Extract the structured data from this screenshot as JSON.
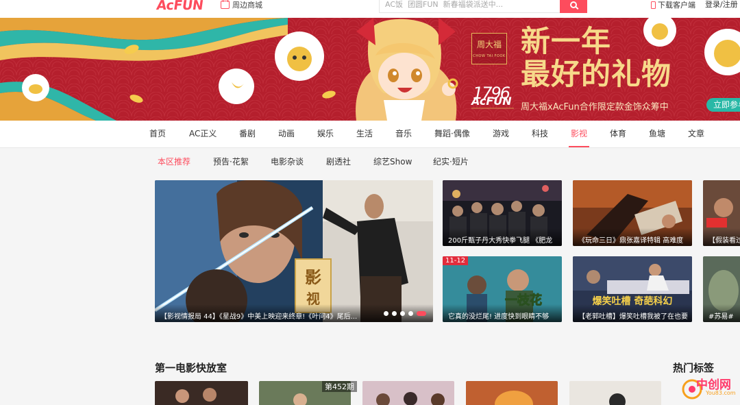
{
  "header": {
    "logo_text": "AcFUN",
    "mall_label": "周边商城",
    "search_placeholder": "AC饭  团圆FUN  新春福袋派送中...",
    "download_label": "下载客户端",
    "login_label": "登录/注册"
  },
  "banner": {
    "brand_cn": "周大福",
    "brand_en": "CHOW TAI FOOK",
    "number_mark": "1796",
    "logo_text": "AcFUN",
    "headline_line1": "新一年",
    "headline_line2": "最好的礼物",
    "collab_text": "周大福xAcFun合作限定款金饰众筹中",
    "join_button": "立即参与"
  },
  "nav": {
    "items": [
      "首页",
      "AC正义",
      "番剧",
      "动画",
      "娱乐",
      "生活",
      "音乐",
      "舞蹈·偶像",
      "游戏",
      "科技",
      "影视",
      "体育",
      "鱼塘",
      "文章"
    ],
    "active": "影视"
  },
  "subnav": {
    "items": [
      "本区推荐",
      "预告·花絮",
      "电影杂谈",
      "剧透社",
      "综艺Show",
      "纪实·短片"
    ],
    "active": "本区推荐"
  },
  "featured": {
    "caption": "【影视情报局 44】《星战9》中美上映迎来终章!《叶问4》尾后...",
    "stamp_text": "影视",
    "slide_count": 5,
    "active_slide": 5
  },
  "cards": [
    {
      "caption": "200斤甄子丹大秀快拳飞腿 《肥龙"
    },
    {
      "caption": "《玩命三日》鼎张嘉译特辑  高难度"
    },
    {
      "caption": "【假装看过"
    },
    {
      "caption": "它真的没烂尾! 进度快到眼睛不够",
      "badge": "11-12",
      "overlay": "一枝花"
    },
    {
      "caption": "【老郭吐槽】爆笑吐槽我被了在也要",
      "overlay": "爆笑吐槽 奇葩科幻"
    },
    {
      "caption": "#苏易#"
    }
  ],
  "section": {
    "title": "第一电影快放室",
    "tags_title": "热门标签",
    "episode_label": "第452期"
  },
  "watermark": {
    "text": "中创网",
    "url": "You83.com"
  },
  "colors": {
    "accent": "#fd4c5d",
    "banner_red": "#b3202e",
    "gold": "#f7d98a"
  }
}
